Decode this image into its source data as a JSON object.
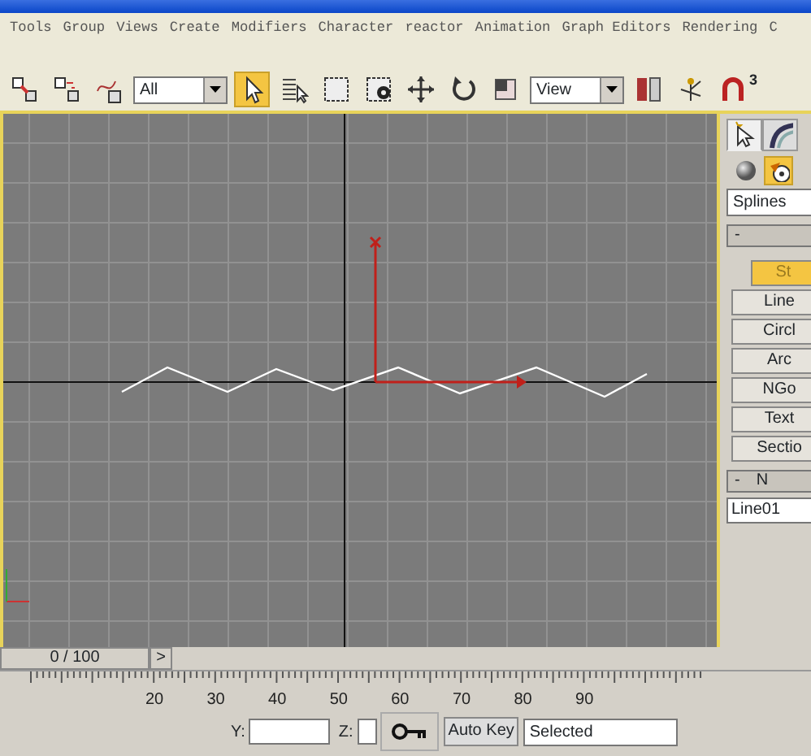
{
  "menu": [
    {
      "label": "Tools"
    },
    {
      "label": "Group"
    },
    {
      "label": "Views"
    },
    {
      "label": "Create"
    },
    {
      "label": "Modifiers"
    },
    {
      "label": "Character"
    },
    {
      "label": "reactor"
    },
    {
      "label": "Animation"
    },
    {
      "label": "Graph Editors"
    },
    {
      "label": "Rendering"
    },
    {
      "label": "C"
    }
  ],
  "toolbar": {
    "items": [
      {
        "kind": "link",
        "selected": false
      },
      {
        "kind": "unlink",
        "selected": false
      },
      {
        "kind": "bind",
        "selected": false
      },
      {
        "kind": "filter",
        "value": "All"
      },
      {
        "kind": "select",
        "selected": true
      },
      {
        "kind": "byname",
        "selected": false
      },
      {
        "kind": "region",
        "selected": false
      },
      {
        "kind": "crossing",
        "selected": false
      },
      {
        "kind": "move",
        "selected": false
      },
      {
        "kind": "rotate",
        "selected": false
      },
      {
        "kind": "scale",
        "selected": false
      },
      {
        "kind": "coords",
        "value": "View"
      },
      {
        "kind": "mirror",
        "selected": false
      },
      {
        "kind": "axis",
        "selected": false
      },
      {
        "kind": "snap",
        "label": "3",
        "selected": false
      }
    ]
  },
  "command_panel": {
    "tabs": [
      {
        "kind": "create",
        "selected": true
      },
      {
        "kind": "modify",
        "selected": false
      }
    ],
    "categories": [
      {
        "kind": "geometry",
        "selected": false
      },
      {
        "kind": "shapes",
        "selected": true
      }
    ],
    "dropdown": "Splines",
    "object_rollout": {
      "toggle": "-",
      "start_button": {
        "label": "St",
        "on": true
      },
      "buttons": [
        {
          "label": "Line"
        },
        {
          "label": "Circl"
        },
        {
          "label": "Arc"
        },
        {
          "label": "NGo"
        },
        {
          "label": "Text"
        },
        {
          "label": "Sectio"
        }
      ]
    },
    "name_rollout": {
      "toggle": "-",
      "title": "N",
      "name_value": "Line01"
    }
  },
  "time_slider": {
    "frame": "0 / 100",
    "next": ">"
  },
  "timeline": {
    "labels": [
      "20",
      "30",
      "40",
      "50",
      "60",
      "70",
      "80",
      "90"
    ]
  },
  "status": {
    "y_label": "Y:",
    "z_label": "Z:",
    "auto_key": "Auto Key",
    "key_mode": "Selected"
  }
}
